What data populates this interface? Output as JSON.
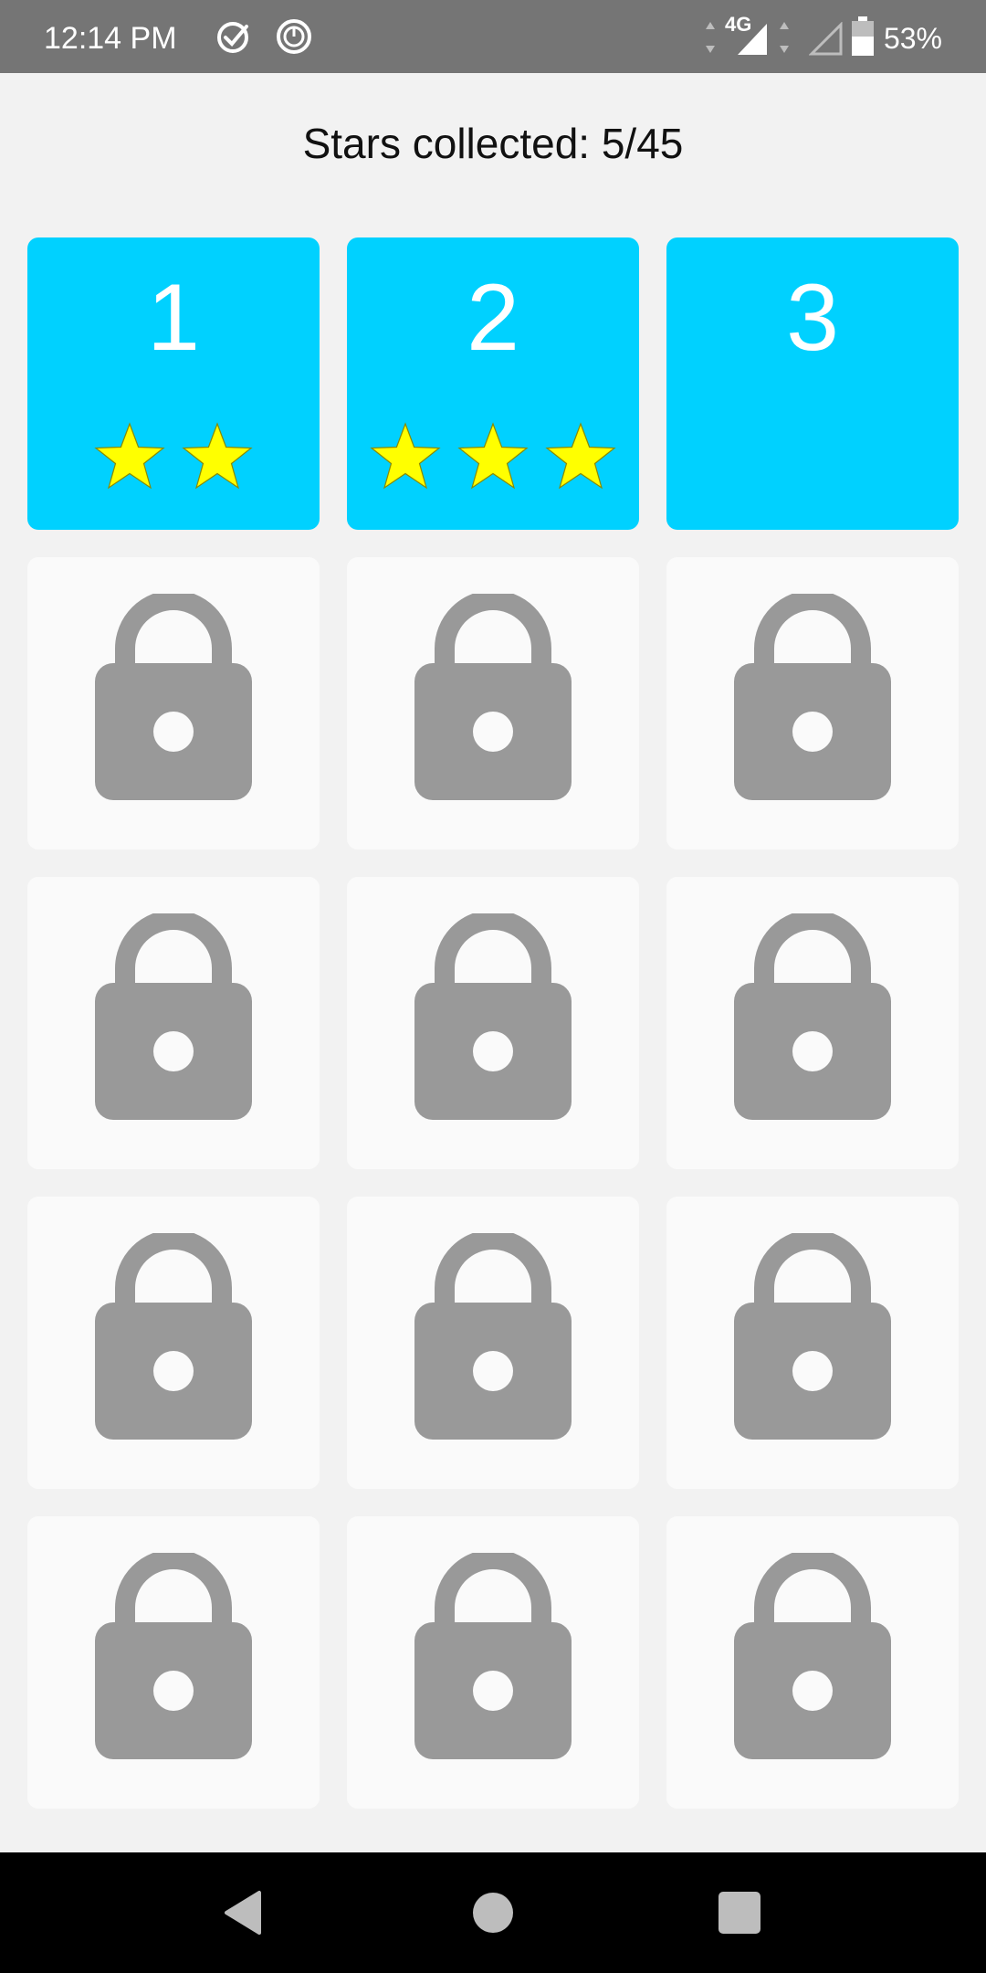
{
  "status_bar": {
    "time": "12:14 PM",
    "network": "4G",
    "battery": "53%"
  },
  "header": {
    "stars_collected": "Stars collected: 5/45"
  },
  "levels": [
    {
      "number": "1",
      "locked": false,
      "stars": 2
    },
    {
      "number": "2",
      "locked": false,
      "stars": 3
    },
    {
      "number": "3",
      "locked": false,
      "stars": 0
    },
    {
      "locked": true
    },
    {
      "locked": true
    },
    {
      "locked": true
    },
    {
      "locked": true
    },
    {
      "locked": true
    },
    {
      "locked": true
    },
    {
      "locked": true
    },
    {
      "locked": true
    },
    {
      "locked": true
    },
    {
      "locked": true
    },
    {
      "locked": true
    },
    {
      "locked": true
    }
  ],
  "colors": {
    "unlocked_tile": "#00d1ff",
    "locked_tile": "#fafafa",
    "lock_icon": "#999999",
    "star": "#ffff00"
  }
}
